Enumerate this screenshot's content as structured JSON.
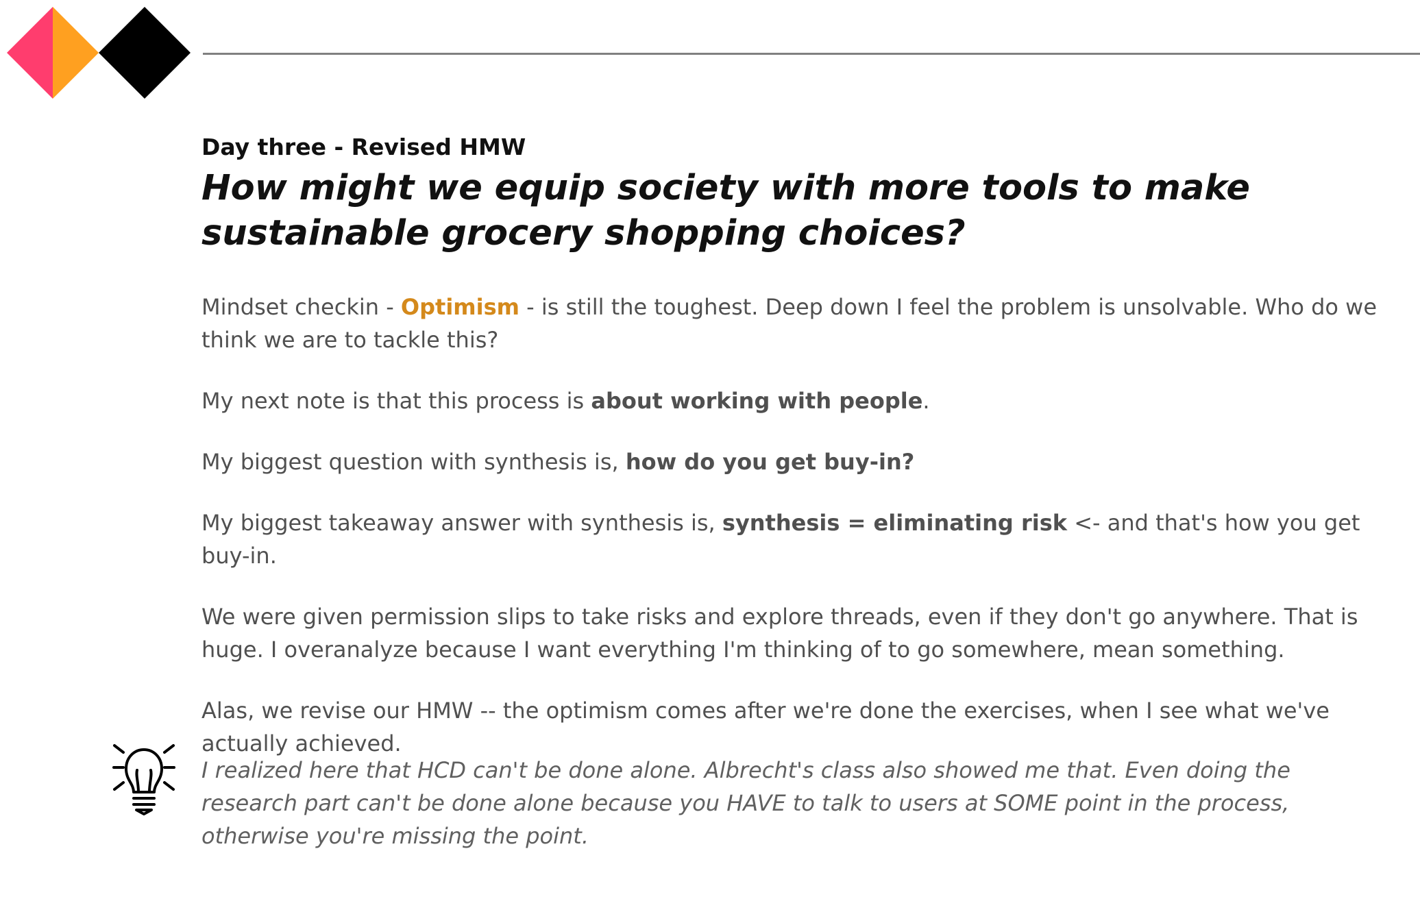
{
  "brand": {
    "colors": {
      "pink": "#ff3d6e",
      "orange": "#ffa020",
      "black": "#000000",
      "rule": "#808080",
      "accent": "#d4891b"
    },
    "icon": "diamond-logo-icon"
  },
  "header": {
    "subtitle": "Day three - Revised HMW",
    "headline": "How might we equip society with more tools to make sustainable grocery shopping choices?"
  },
  "paragraphs": {
    "p1": {
      "before": "Mindset checkin - ",
      "highlight": "Optimism",
      "after": " - is still the toughest. Deep down I feel the problem is unsolvable. Who do we think we are to tackle this?"
    },
    "p2": {
      "before": "My next note is that this process is ",
      "bold": "about working with people",
      "after": "."
    },
    "p3": {
      "before": "My biggest question with synthesis is, ",
      "bold": "how do you get buy-in?"
    },
    "p4": {
      "before": "My biggest takeaway answer with synthesis is, ",
      "bold": "synthesis = eliminating risk",
      "after": " <- and that's how you get buy-in."
    },
    "p5": {
      "text": "We were given permission slips to take risks and explore threads, even if they don't go anywhere. That is huge. I overanalyze because I want everything I'm thinking of to go somewhere, mean something."
    },
    "p6": {
      "text": "Alas, we revise our HMW -- the optimism comes after we're done the exercises, when I see what we've actually achieved."
    }
  },
  "insight": {
    "icon": "lightbulb-icon",
    "text": "I realized here that HCD can't be done alone. Albrecht's class also showed me that. Even doing the research part can't be done alone because you HAVE to talk to users at SOME point in the process, otherwise you're missing the point."
  }
}
